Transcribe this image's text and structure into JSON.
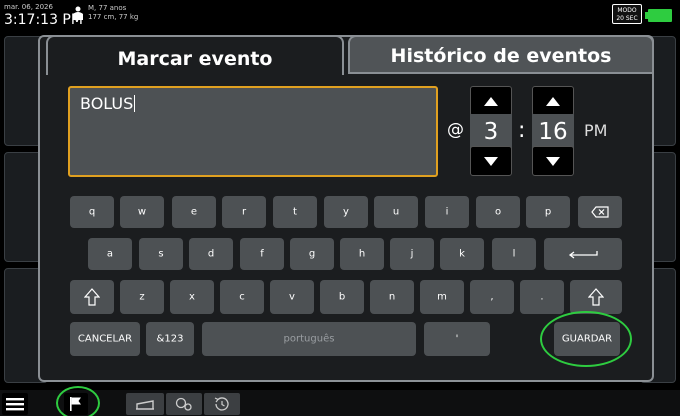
{
  "status_bar": {
    "date": "mar. 06, 2026",
    "time": "3:17:13 PM",
    "patient_line1": "M, 77 anos",
    "patient_line2": "177 cm, 77 kg",
    "mode_line1": "MODO",
    "mode_line2": "20 SEC",
    "battery_color": "#2ecc40"
  },
  "dialog": {
    "tabs": [
      {
        "label": "Marcar evento",
        "active": true
      },
      {
        "label": "Histórico de eventos",
        "active": false
      }
    ],
    "event_text": "BOLUS",
    "at_sign": "@",
    "time": {
      "hour": "3",
      "separator": ":",
      "minute": "16",
      "ampm": "PM"
    }
  },
  "keyboard": {
    "row1": [
      "q",
      "w",
      "e",
      "r",
      "t",
      "y",
      "u",
      "i",
      "o",
      "p"
    ],
    "row2": [
      "a",
      "s",
      "d",
      "f",
      "g",
      "h",
      "j",
      "k",
      "l"
    ],
    "row3": [
      "z",
      "x",
      "c",
      "v",
      "b",
      "n",
      "m",
      ",",
      "."
    ],
    "cancel_label": "CANCELAR",
    "symbols_label": "&123",
    "space_label": "português",
    "apostrophe_label": "'",
    "save_label": "GUARDAR",
    "backspace_icon": "backspace-icon",
    "enter_icon": "enter-icon",
    "shift_icon": "shift-icon"
  },
  "bottom_bar": {
    "icons": [
      "menu-icon",
      "flag-icon",
      "bed-icon",
      "settings-icon",
      "history-icon"
    ]
  },
  "colors": {
    "input_border": "#e0a020",
    "highlight": "#2ecc40",
    "key_bg": "#4d5154"
  }
}
